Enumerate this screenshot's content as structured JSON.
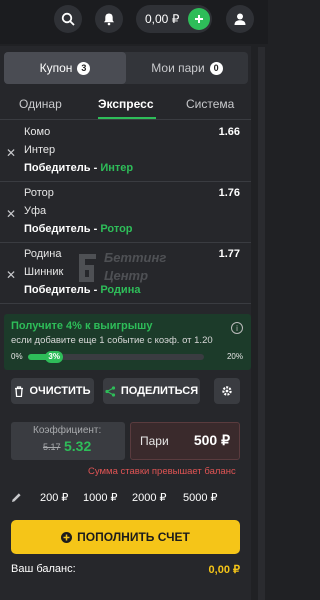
{
  "topbar": {
    "balance": "0,00 ₽",
    "icons": [
      "search-icon",
      "bell-icon",
      "plus-icon",
      "user-icon"
    ]
  },
  "coupon": {
    "tabs": [
      {
        "label": "Купон",
        "count": "3"
      },
      {
        "label": "Мои пари",
        "count": "0"
      }
    ],
    "subtabs": [
      "Одинар",
      "Экспресс",
      "Система"
    ],
    "bets": [
      {
        "team1": "Комо",
        "team2": "Интер",
        "market": "Победитель - ",
        "pick": "Интер",
        "odd": "1.66"
      },
      {
        "team1": "Ротор",
        "team2": "Уфа",
        "market": "Победитель - ",
        "pick": "Ротор",
        "odd": "1.76"
      },
      {
        "team1": "Родина",
        "team2": "Шинник",
        "market": "Победитель - ",
        "pick": "Родина",
        "odd": "1.77"
      }
    ]
  },
  "watermark": {
    "line1": "Беттинг",
    "line2": "Центр"
  },
  "promo": {
    "title": "Получите 4% к выигрышу",
    "subtitle": "если добавите еще 1 событие с коэф. от 1.20",
    "min": "0%",
    "max": "20%",
    "current": "3%",
    "progress_fraction": 0.15
  },
  "actions": {
    "clear": "ОЧИСТИТЬ",
    "share": "ПОДЕЛИТЬСЯ"
  },
  "coefficient": {
    "label": "Коэффициент:",
    "old": "5.17",
    "new": "5.32"
  },
  "stake": {
    "label": "Пари",
    "value": "500 ₽",
    "error": "Сумма ставки превышает баланс"
  },
  "quick_amounts": [
    "200 ₽",
    "1000 ₽",
    "2000 ₽",
    "5000 ₽"
  ],
  "deposit": {
    "label": "ПОПОЛНИТЬ СЧЕТ"
  },
  "balance": {
    "label": "Ваш баланс:",
    "value": "0,00 ₽"
  },
  "colors": {
    "accent": "#2ebd59",
    "warning": "#f5c518",
    "error": "#e05454"
  }
}
